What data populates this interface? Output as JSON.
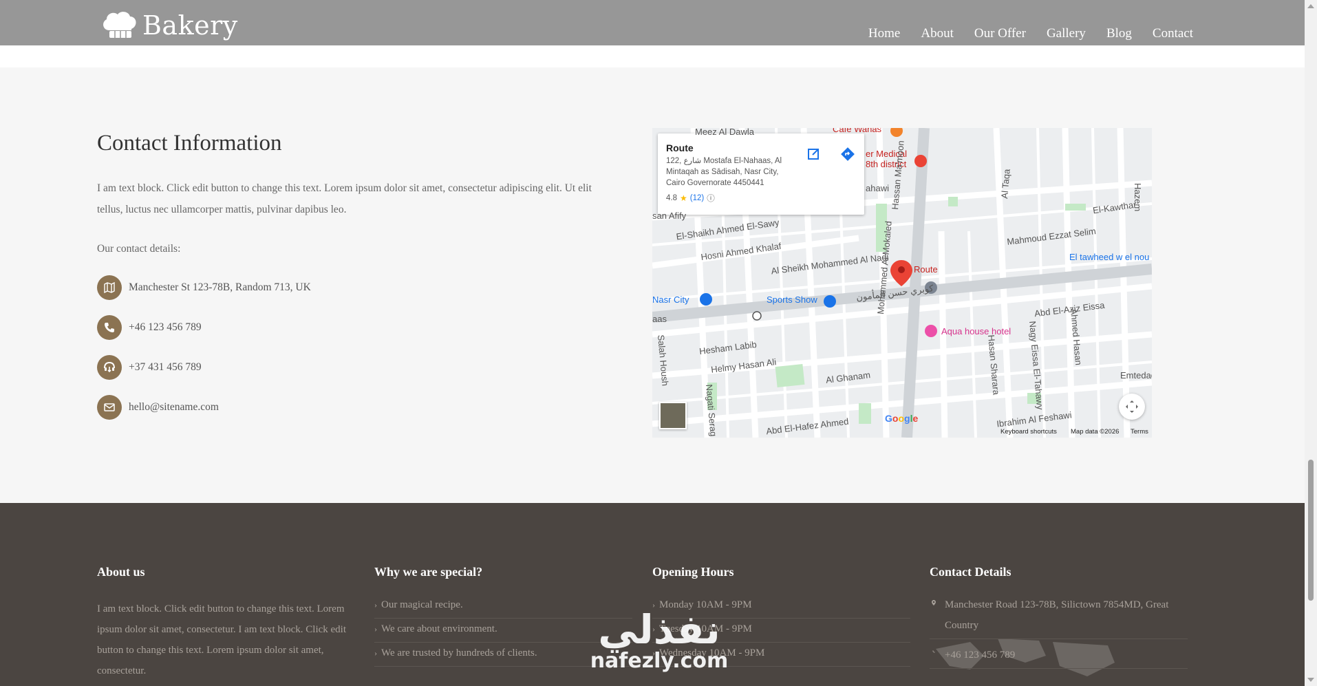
{
  "header": {
    "logo_text": "Bakery",
    "nav": [
      "Home",
      "About",
      "Our Offer",
      "Gallery",
      "Blog",
      "Contact"
    ]
  },
  "contact": {
    "title": "Contact Information",
    "text": "I am text block. Click edit button to change this text. Lorem ipsum dolor sit amet, consectetur adipiscing elit. Ut elit tellus, luctus nec ullamcorper mattis, pulvinar dapibus leo.",
    "details_label": "Our contact details:",
    "address": "Manchester St 123-78B, Random 713, UK",
    "phone": "+46 123 456 789",
    "fax": "+37 431 456 789",
    "email": "hello@sitename.com"
  },
  "map": {
    "card_title": "Route",
    "card_address": "122, شارع Mostafa El-Nahaas, Al Mintaqah as Sādisah, Nasr City, Cairo Governorate 4450441",
    "rating": "4.8",
    "reviews": "(12)",
    "labels": {
      "route": "Route",
      "sports_show": "Sports Show",
      "aqua_house": "Aqua house hotel",
      "nasr_city": "Nasr City",
      "el_tawheed": "El tawheed w el nou",
      "medical": "er Medical",
      "district": "8th district",
      "cafe": "Cafe Wanas",
      "hosni": "Hosni Ahmed Khalaf",
      "sheikh_sawy": "El-Shaikh Ahmed El-Sawy",
      "sheikh_nadi": "Al Sheikh Mohammed Al Nadi",
      "mahmoud": "Mahmoud Ezzat Selim",
      "abd_eissa": "Abd El-Aziz Eissa",
      "hesham": "Hesham Labib",
      "helmy": "Helmy Hasan Ali",
      "ghanam": "Al Ghanam",
      "abd_hafez": "Abd El-Hafez Ahmed",
      "ibrahim": "Ibrahim Al Feshawi",
      "emtedad": "Emtedad",
      "kawthar": "El-Kawthar",
      "hassan_mamoon": "Hassan Ma'moon",
      "al_taqa": "Al Taqa",
      "hazem": "Hazem",
      "salah": "Salah Housh",
      "nagati": "Nagati Serag",
      "mokaled": "Mohammed Al Mokaled",
      "hasan_sharara": "Hasan Sharara",
      "nagy": "Nagy Eissa El-Tahawy",
      "ahmed_hasan": "Ahmed Hasan",
      "meez": "Meez Al Dawla",
      "sahawi": "ahawi",
      "san_afify": "san Afify",
      "kobry": "كوبري حسن المأمون",
      "aas": "aas"
    },
    "google": "Google",
    "keyboard": "Keyboard shortcuts",
    "mapdata": "Map data ©2026",
    "terms": "Terms"
  },
  "footer": {
    "about": {
      "title": "About us",
      "text": "I am text block. Click edit button to change this text. Lorem ipsum dolor sit amet, consectetur. I am text block. Click edit button to change this text. Lorem ipsum dolor sit amet, consectetur."
    },
    "special": {
      "title": "Why we are special?",
      "items": [
        "Our magical recipe.",
        "We care about environment.",
        "We are trusted by hundreds of clients."
      ]
    },
    "hours": {
      "title": "Opening Hours",
      "items": [
        "Monday 10AM - 9PM",
        "Tuesday 10AM - 9PM",
        "Wednesday 10AM - 9PM"
      ]
    },
    "contact": {
      "title": "Contact Details",
      "address": "Manchester Road 123-78B, Silictown 7854MD, Great Country",
      "phone": "+46 123 456 789"
    }
  },
  "watermark": {
    "arabic": "نفذلي",
    "latin": "nafezly.com"
  },
  "colors": {
    "header_bg": "#979797",
    "accent": "#8b7352",
    "footer_bg": "#4b4541"
  }
}
